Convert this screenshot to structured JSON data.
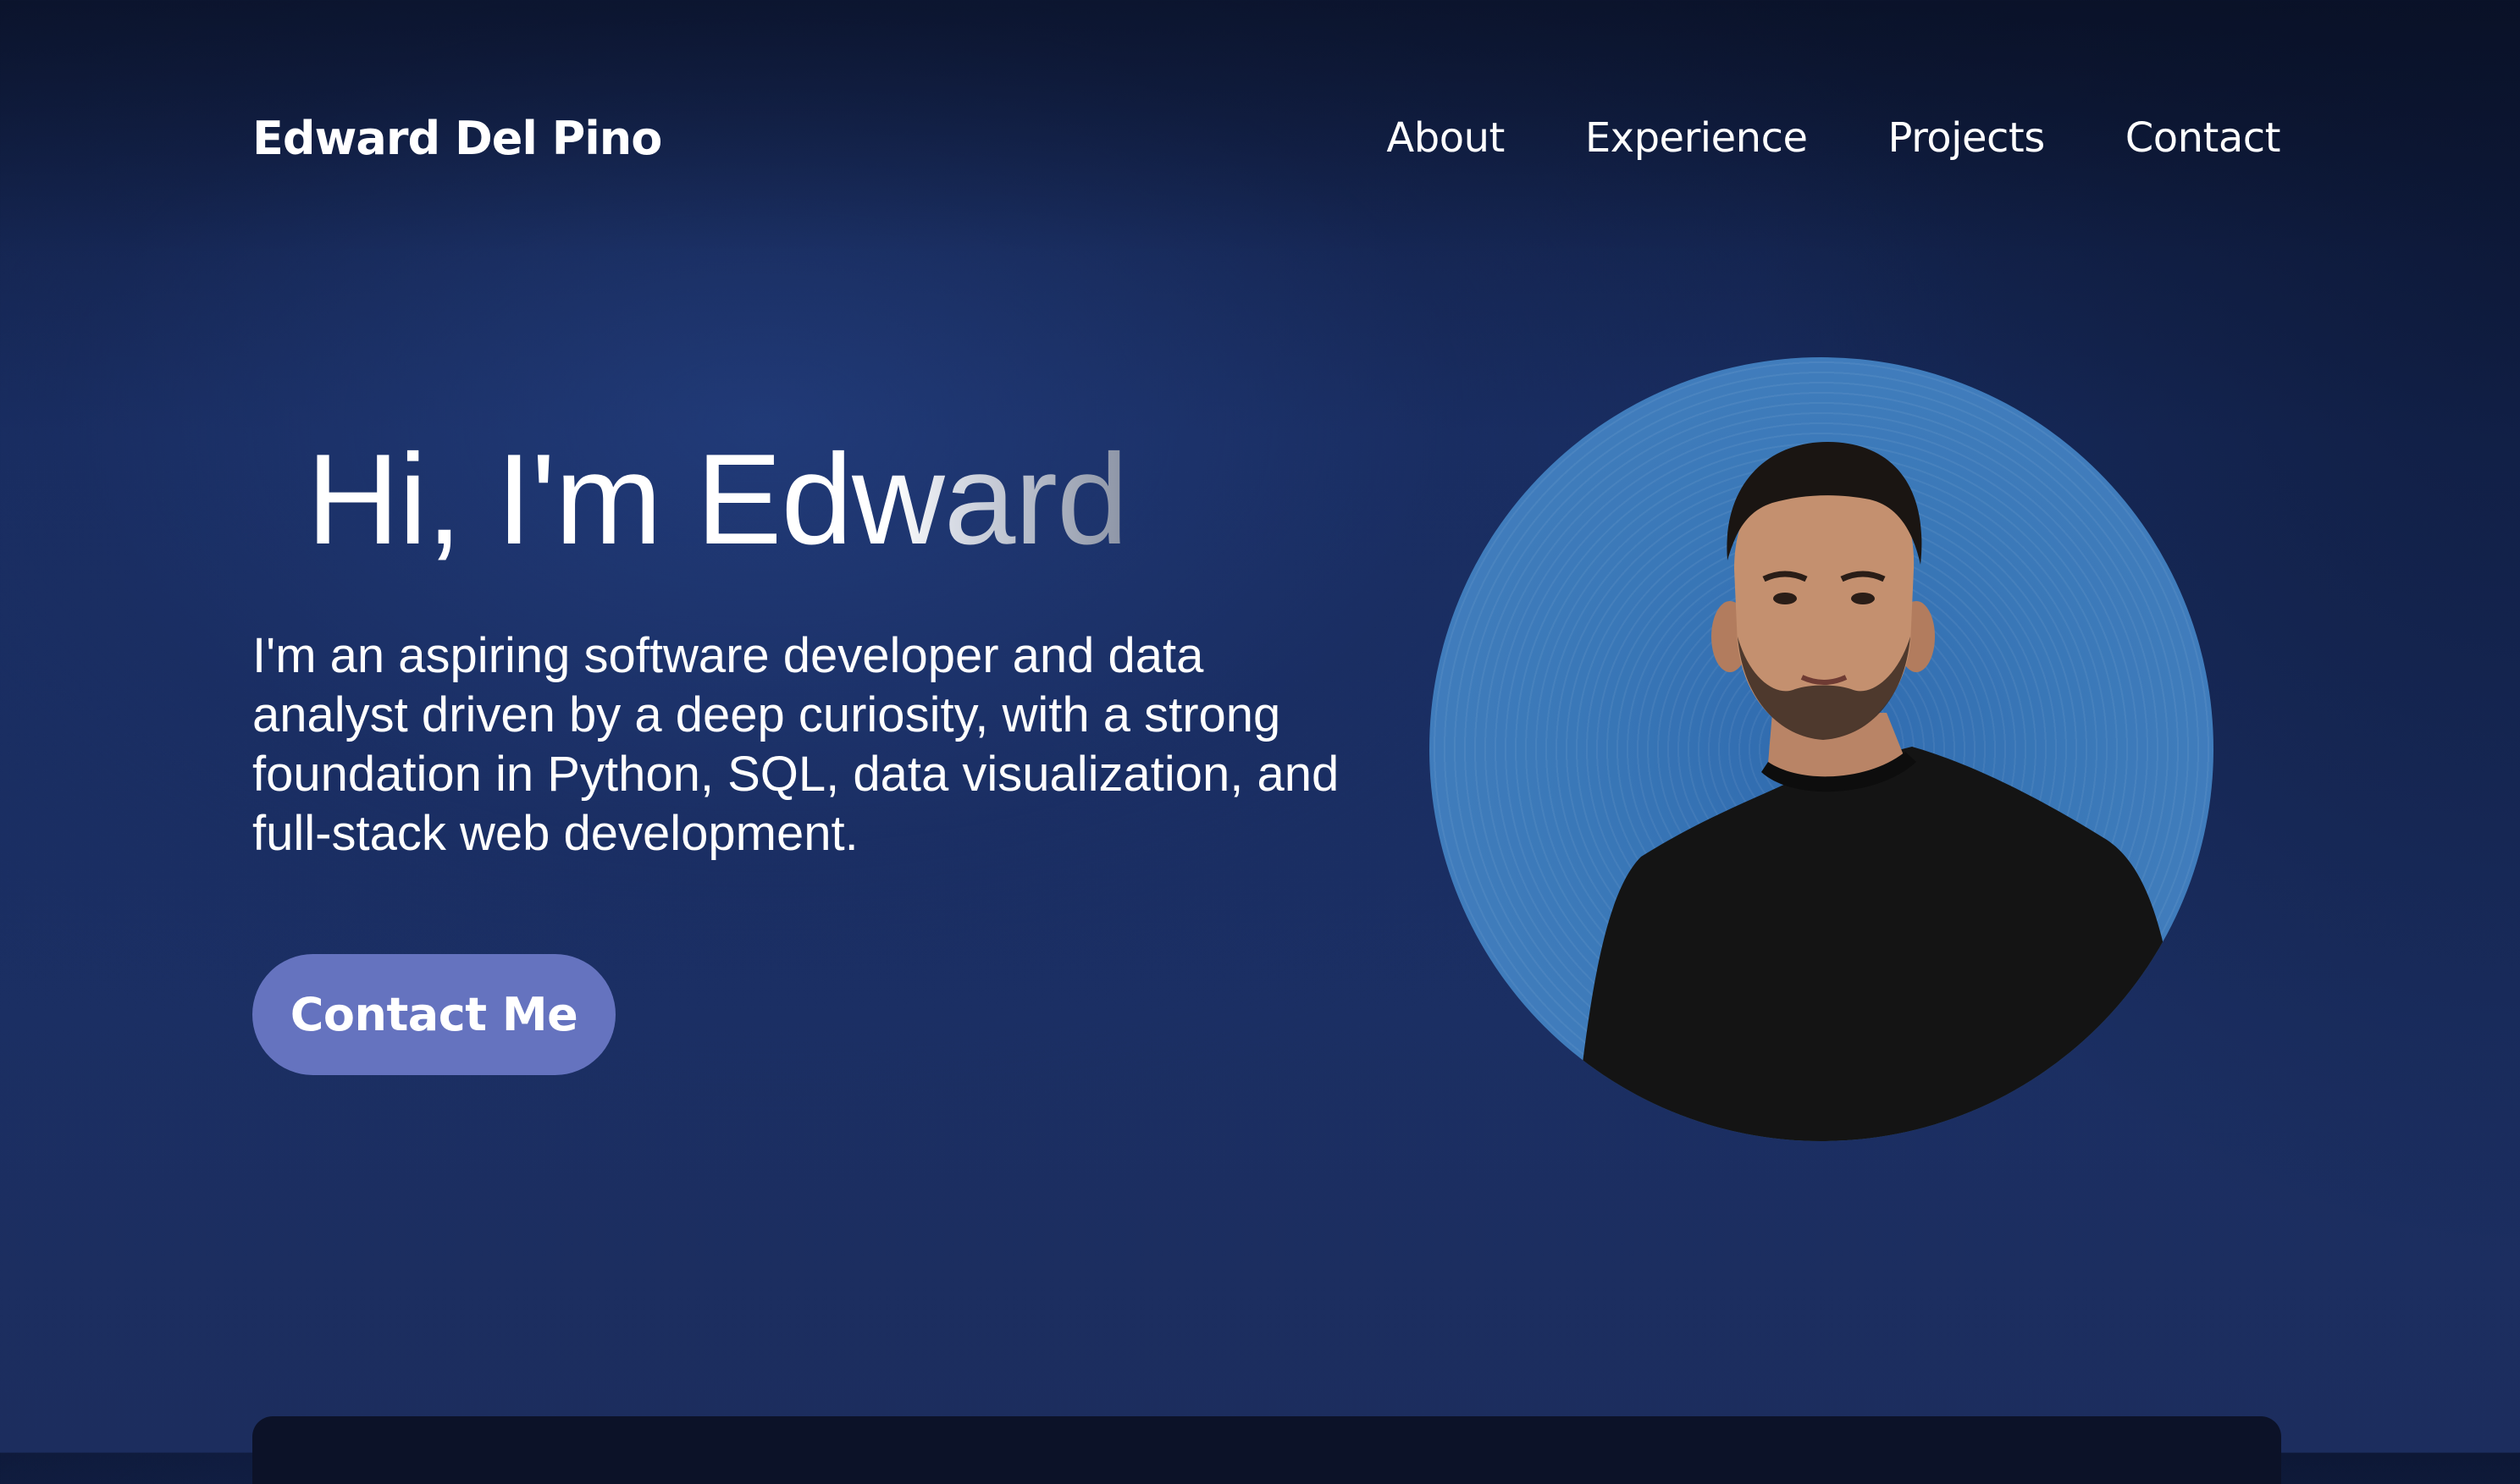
{
  "nav": {
    "brand": "Edward Del Pino",
    "links": [
      {
        "label": "About"
      },
      {
        "label": "Experience"
      },
      {
        "label": "Projects"
      },
      {
        "label": "Contact"
      }
    ]
  },
  "hero": {
    "title": "Hi, I'm Edward",
    "description": "I'm an aspiring software developer and data analyst driven by a deep curiosity, with a strong foundation in Python, SQL, data visualization, and full-stack web development.",
    "cta_label": "Contact Me"
  },
  "colors": {
    "background": "#1b2f63",
    "cta": "#6573bf",
    "portrait_ring": "#3a78b8",
    "text": "#ffffff"
  }
}
